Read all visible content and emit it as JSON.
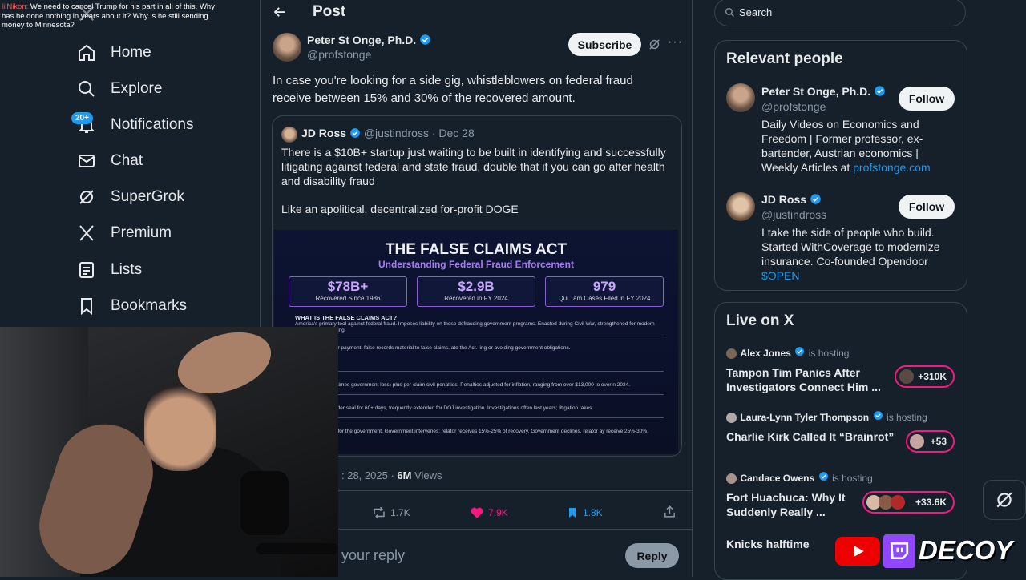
{
  "stream_chat": {
    "user": "lilNikon:",
    "text": " We need to cancel Trump for his part in all of this. Why has he done nothing in years about it? Why is he still sending money to Minnesota?"
  },
  "nav": {
    "items": [
      {
        "label": "Home",
        "icon": "home-icon"
      },
      {
        "label": "Explore",
        "icon": "search-icon"
      },
      {
        "label": "Notifications",
        "icon": "bell-icon"
      },
      {
        "label": "Chat",
        "icon": "mail-icon"
      },
      {
        "label": "SuperGrok",
        "icon": "grok-icon"
      },
      {
        "label": "Premium",
        "icon": "x-logo-icon"
      },
      {
        "label": "Lists",
        "icon": "list-icon"
      },
      {
        "label": "Bookmarks",
        "icon": "bookmark-icon"
      }
    ],
    "notifications_badge": "20+"
  },
  "post": {
    "header_title": "Post",
    "author_name": "Peter St Onge, Ph.D.",
    "author_handle": "@profstonge",
    "subscribe_label": "Subscribe",
    "text": "In case you're looking for a side gig, whistleblowers on federal fraud receive between 15% and 30% of the recovered amount.",
    "quote": {
      "author_name": "JD Ross",
      "author_handle": "@justindross",
      "date": "· Dec 28",
      "text1": "There is a $10B+ startup just waiting to be built in identifying and successfully litigating against federal and state fraud, double that if you can go after health and disability fraud",
      "text2": "Like an apolitical, decentralized for-profit DOGE",
      "infographic": {
        "title": "THE FALSE CLAIMS ACT",
        "subtitle": "Understanding Federal Fraud Enforcement",
        "stats": [
          {
            "value": "$78B+",
            "label": "Recovered Since 1986"
          },
          {
            "value": "$2.9B",
            "label": "Recovered in FY 2024"
          },
          {
            "value": "979",
            "label": "Qui Tam Cases Filed in FY 2024"
          }
        ],
        "sections": [
          {
            "heading": "WHAT IS THE FALSE CLAIMS ACT?",
            "body": "America's primary tool against federal fraud. Imposes liability on those defrauding government programs. Enacted during Civil War, strengthened for modern ages citizen reporting."
          },
          {
            "heading": "RS LIABILITY?",
            "body": "ting false claims for payment. false records material to false claims. ate the Act. ling or avoiding government obligations."
          },
          {
            "heading": "RECOVERY",
            "body": "e damages (three times government loss) plus per-claim civil penalties. Penalties adjusted for inflation, ranging from over $13,000 to over n 2024."
          },
          {
            "heading": "ES",
            "body": "n lengthy. Filed under seal for 60+ days, frequently extended for DOJ investigation. Investigations often last years; litigation takes"
          },
          {
            "heading": "PROVISION",
            "body": "ators) file lawsuits for the government. Government intervenes: relator receives 15%-25% of recovery. Government declines, relator ay receive 25%-30%."
          }
        ]
      }
    },
    "timestamp": ": 28, 2025 · ",
    "views_count": "6M",
    "views_label": " Views",
    "reposts": "1.7K",
    "likes": "7.9K",
    "bookmarks": "1.8K",
    "reply_placeholder": "your reply",
    "reply_label": "Reply"
  },
  "search": {
    "placeholder": "Search"
  },
  "relevant_people": {
    "title": "Relevant people",
    "people": [
      {
        "name": "Peter St Onge, Ph.D.",
        "handle": "@profstonge",
        "bio": "Daily Videos on Economics and Freedom | Former professor, ex-bartender, Austrian economics | Weekly Articles at ",
        "link": "profstonge.com",
        "follow": "Follow"
      },
      {
        "name": "JD Ross",
        "handle": "@justindross",
        "bio": "I take the side of people who build. Started WithCoverage to modernize insurance. Co-founded Opendoor ",
        "link": "$OPEN",
        "follow": "Follow"
      }
    ]
  },
  "live": {
    "title": "Live on X",
    "is_hosting": "is hosting",
    "items": [
      {
        "host": "Alex Jones",
        "title": "Tampon Tim Panics After Investigators Connect Him ...",
        "count": "+310K"
      },
      {
        "host": "Laura-Lynn Tyler Thompson",
        "title": "Charlie Kirk Called It “Brainrot”",
        "count": "+53"
      },
      {
        "host": "Candace Owens",
        "title": "Fort Huachuca: Why It Suddenly Really ...",
        "count": "+33.6K"
      },
      {
        "host": "",
        "title": "Knicks halftime",
        "count": ""
      }
    ]
  },
  "overlay": {
    "brand": "DECOY"
  },
  "colors": {
    "accent": "#1d9bf0",
    "like": "#f91880",
    "bg": "#15202b",
    "border": "#38444d"
  }
}
